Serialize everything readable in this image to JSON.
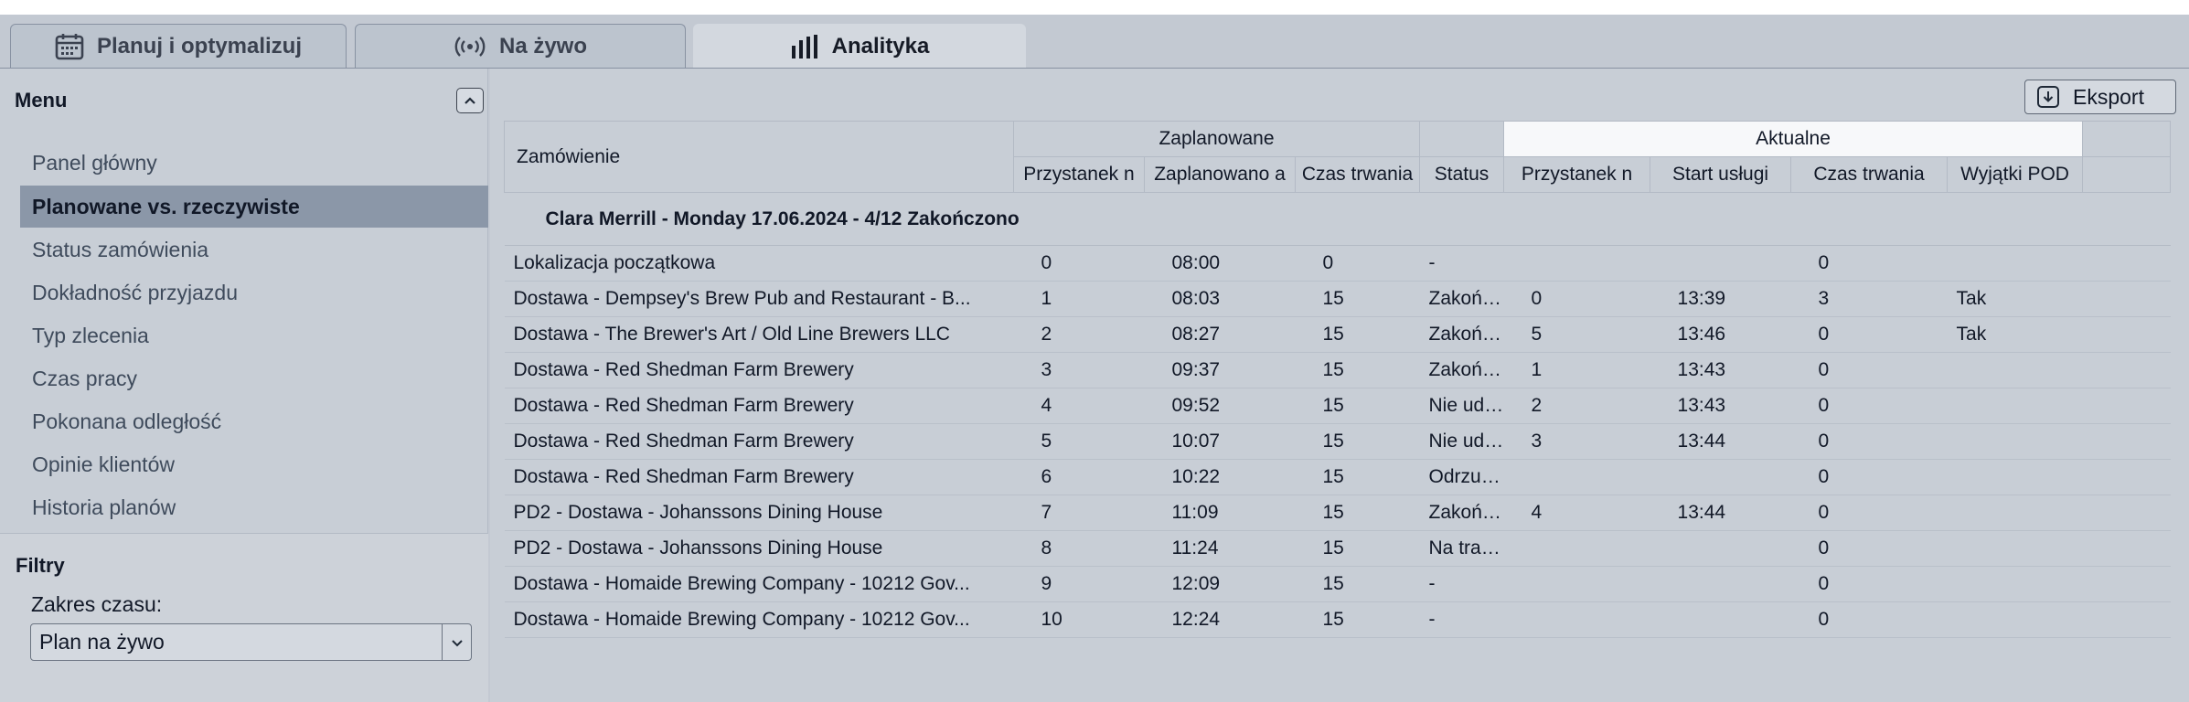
{
  "tabs": [
    {
      "label": "Planuj i optymalizuj",
      "icon": "calendar-icon",
      "active": false
    },
    {
      "label": "Na żywo",
      "icon": "live-signal-icon",
      "active": false
    },
    {
      "label": "Analityka",
      "icon": "bar-chart-icon",
      "active": true
    }
  ],
  "sidebar": {
    "menu_title": "Menu",
    "items": [
      {
        "label": "Panel główny",
        "active": false
      },
      {
        "label": "Planowane vs. rzeczywiste",
        "active": true
      },
      {
        "label": "Status zamówienia",
        "active": false
      },
      {
        "label": "Dokładność przyjazdu",
        "active": false
      },
      {
        "label": "Typ zlecenia",
        "active": false
      },
      {
        "label": "Czas pracy",
        "active": false
      },
      {
        "label": "Pokonana odległość",
        "active": false
      },
      {
        "label": "Opinie klientów",
        "active": false
      },
      {
        "label": "Historia planów",
        "active": false
      }
    ],
    "filters_title": "Filtry",
    "time_range_label": "Zakres czasu:",
    "time_range_value": "Plan na żywo"
  },
  "toolbar": {
    "export_label": "Eksport"
  },
  "table": {
    "order_header": "Zamówienie",
    "planned_group": "Zaplanowane",
    "actual_group": "Aktualne",
    "columns": [
      "Przystanek n",
      "Zaplanowano a",
      "Czas trwania",
      "Status",
      "Przystanek n",
      "Start usługi",
      "Czas trwania",
      "Wyjątki POD"
    ],
    "group_label": "Clara Merrill - Monday 17.06.2024 - 4/12 Zakończono",
    "rows": [
      [
        "Lokalizacja początkowa",
        "0",
        "08:00",
        "0",
        "-",
        "",
        "",
        "0",
        ""
      ],
      [
        "Dostawa - Dempsey's Brew Pub and Restaurant - B...",
        "1",
        "08:03",
        "15",
        "Zakończono",
        "0",
        "13:39",
        "3",
        "Tak"
      ],
      [
        "Dostawa - The Brewer's Art / Old Line Brewers LLC",
        "2",
        "08:27",
        "15",
        "Zakończono",
        "5",
        "13:46",
        "0",
        "Tak"
      ],
      [
        "Dostawa - Red Shedman Farm Brewery",
        "3",
        "09:37",
        "15",
        "Zakończono",
        "1",
        "13:43",
        "0",
        ""
      ],
      [
        "Dostawa - Red Shedman Farm Brewery",
        "4",
        "09:52",
        "15",
        "Nie udało się",
        "2",
        "13:43",
        "0",
        ""
      ],
      [
        "Dostawa - Red Shedman Farm Brewery",
        "5",
        "10:07",
        "15",
        "Nie udało się",
        "3",
        "13:44",
        "0",
        ""
      ],
      [
        "Dostawa - Red Shedman Farm Brewery",
        "6",
        "10:22",
        "15",
        "Odrzucone",
        "",
        "",
        "0",
        ""
      ],
      [
        "PD2 - Dostawa - Johanssons Dining House",
        "7",
        "11:09",
        "15",
        "Zakończono",
        "4",
        "13:44",
        "0",
        ""
      ],
      [
        "PD2 - Dostawa - Johanssons Dining House",
        "8",
        "11:24",
        "15",
        "Na trasie",
        "",
        "",
        "0",
        ""
      ],
      [
        "Dostawa - Homaide Brewing Company - 10212 Gov...",
        "9",
        "12:09",
        "15",
        "-",
        "",
        "",
        "0",
        ""
      ],
      [
        "Dostawa - Homaide Brewing Company - 10212 Gov...",
        "10",
        "12:24",
        "15",
        "-",
        "",
        "",
        "0",
        ""
      ]
    ]
  }
}
